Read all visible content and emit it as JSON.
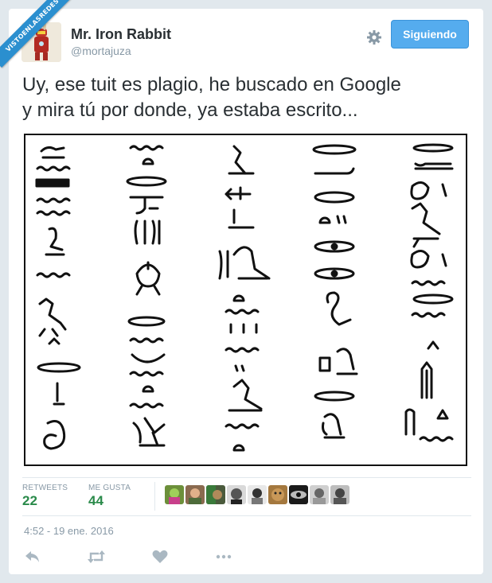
{
  "watermark": "VISTOENLASREDES",
  "author": {
    "name": "Mr. Iron Rabbit",
    "handle": "@mortajuza"
  },
  "follow_button": {
    "label": "Siguiendo"
  },
  "tweet": {
    "text_line1": "Uy, ese tuit es plagio, he buscado en Google",
    "text_line2": "y mira tú por donde, ya estaba escrito..."
  },
  "stats": {
    "retweets_label": "RETWEETS",
    "retweets_count": "22",
    "likes_label": "ME GUSTA",
    "likes_count": "44"
  },
  "timestamp": "4:52 - 19 ene. 2016",
  "colors": {
    "accent": "#55acee",
    "stat_green": "#2a8a4a",
    "muted": "#8899a6"
  },
  "icons": [
    "gear-icon",
    "reply-icon",
    "retweet-icon",
    "like-icon",
    "more-icon"
  ]
}
